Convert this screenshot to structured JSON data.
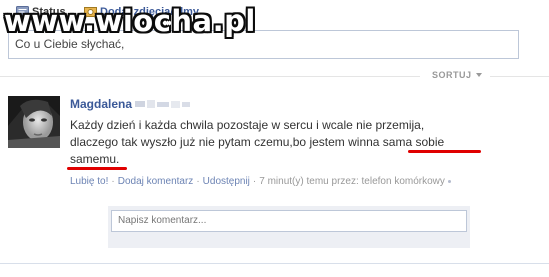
{
  "composer": {
    "tabs": [
      {
        "label": "Status",
        "icon": "status-icon"
      },
      {
        "label": "Dodaj zdjęcia/filmy",
        "icon": "photo-icon"
      }
    ],
    "input_placeholder": "Co u Ciebie słychać,"
  },
  "watermark": "www.wiocha.pl",
  "feed": {
    "sort_label": "SORTUJ"
  },
  "post": {
    "author": "Magdalena",
    "text_lines": [
      "Każdy dzień i każda chwila pozostaje w sercu i wcale nie przemija,",
      "dlaczego tak wyszło już nie pytam czemu,bo jestem winna sama sobie",
      "samemu."
    ],
    "actions": {
      "like": "Lubię to!",
      "comment": "Dodaj komentarz",
      "share": "Udostępnij",
      "time": "7 minut(y) temu przez: telefon komórkowy"
    },
    "comment_placeholder": "Napisz komentarz..."
  },
  "colors": {
    "link": "#3b5998",
    "meta_link": "#6d84b4",
    "highlight": "#e00000",
    "border": "#bdc7d8"
  }
}
